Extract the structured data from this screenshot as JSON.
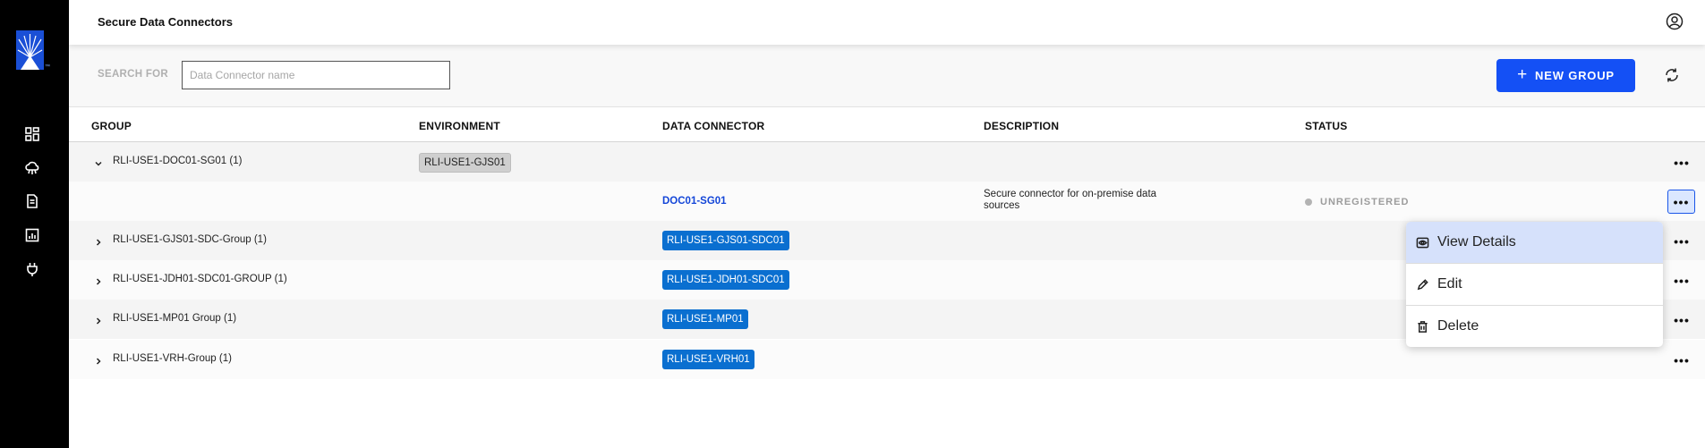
{
  "header": {
    "title": "Secure Data Connectors"
  },
  "sidebar": {
    "logo_mark": "™",
    "items": [
      "dashboard-icon",
      "cloud-network-icon",
      "document-icon",
      "report-icon",
      "plug-icon"
    ]
  },
  "toolbar": {
    "search_label": "SEARCH FOR",
    "search_placeholder": "Data Connector name",
    "search_value": "",
    "new_group_label": "NEW GROUP",
    "new_group_icon": "+"
  },
  "table": {
    "columns": [
      "GROUP",
      "ENVIRONMENT",
      "DATA CONNECTOR",
      "DESCRIPTION",
      "STATUS"
    ],
    "rows": [
      {
        "group": "RLI-USE1-DOC01-SG01 (1)",
        "expanded": true,
        "environment": "RLI-USE1-GJS01",
        "connector": "",
        "description": "",
        "status": ""
      },
      {
        "group": "",
        "environment": "",
        "connector": "DOC01-SG01",
        "description": "Secure connector for on-premise data sources",
        "status": "UNREGISTERED"
      },
      {
        "group": "RLI-USE1-GJS01-SDC-Group (1)",
        "expanded": false,
        "environment": "",
        "connector": "RLI-USE1-GJS01-SDC01",
        "description": "",
        "status": ""
      },
      {
        "group": "RLI-USE1-JDH01-SDC01-GROUP (1)",
        "expanded": false,
        "environment": "",
        "connector": "RLI-USE1-JDH01-SDC01",
        "description": "",
        "status": ""
      },
      {
        "group": "RLI-USE1-MP01 Group (1)",
        "expanded": false,
        "environment": "",
        "connector": "RLI-USE1-MP01",
        "description": "",
        "status": ""
      },
      {
        "group": "RLI-USE1-VRH-Group (1)",
        "expanded": false,
        "environment": "",
        "connector": "RLI-USE1-VRH01",
        "description": "",
        "status": ""
      }
    ],
    "more_label": "•••"
  },
  "context_menu": {
    "items": [
      {
        "label": "View Details",
        "icon": "eye-icon"
      },
      {
        "label": "Edit",
        "icon": "pencil-icon"
      },
      {
        "label": "Delete",
        "icon": "trash-icon"
      }
    ]
  },
  "colors": {
    "primary": "#1450f5",
    "connector_tag": "#0a6fd0",
    "link": "#1446d8",
    "menu_highlight": "#d6e1fb",
    "sidebar": "#000000"
  }
}
